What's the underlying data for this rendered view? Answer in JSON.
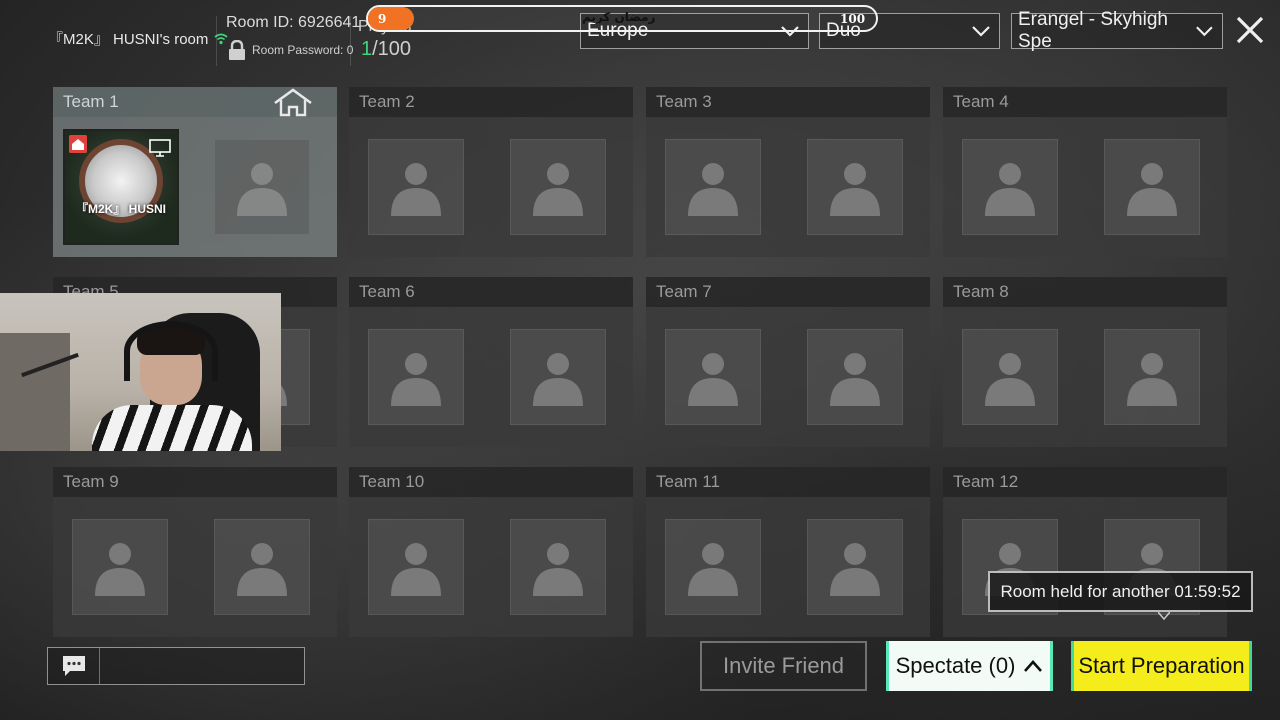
{
  "header": {
    "room_name": "『M2K』 HUSNI's room",
    "room_id": "Room ID: 6926641",
    "room_password": "Room Password: 0",
    "players_label": "Players",
    "players_current": "1",
    "players_max": "/100",
    "region": "Europe",
    "mode": "Duo",
    "map": "Erangel - Skyhigh Spe"
  },
  "overlay": {
    "text": "رمضان كريم",
    "current": "9",
    "max": "100",
    "progress": 0.09,
    "fill_color": "#f07222"
  },
  "teams": [
    {
      "label": "Team 1",
      "active": true,
      "player_name": "『M2K』 HUSNI"
    },
    {
      "label": "Team 2"
    },
    {
      "label": "Team 3"
    },
    {
      "label": "Team 4"
    },
    {
      "label": "Team 5"
    },
    {
      "label": "Team 6"
    },
    {
      "label": "Team 7"
    },
    {
      "label": "Team 8"
    },
    {
      "label": "Team 9"
    },
    {
      "label": "Team 10"
    },
    {
      "label": "Team 11"
    },
    {
      "label": "Team 12"
    }
  ],
  "footer": {
    "invite_label": "Invite Friend",
    "spectate_label": "Spectate (0)",
    "start_label": "Start Preparation",
    "tooltip": "Room held for another 01:59:52"
  },
  "colors": {
    "accent_yellow": "#f5ec1b",
    "accent_teal": "#3ddc9c",
    "players_green": "#3fd47a",
    "wifi_green": "#3fd47a"
  },
  "icons": [
    "wifi-icon",
    "lock-icon",
    "chevron-down-icon",
    "close-icon",
    "home-icon",
    "person-icon",
    "monitor-icon",
    "chat-icon",
    "caret-up-icon"
  ]
}
